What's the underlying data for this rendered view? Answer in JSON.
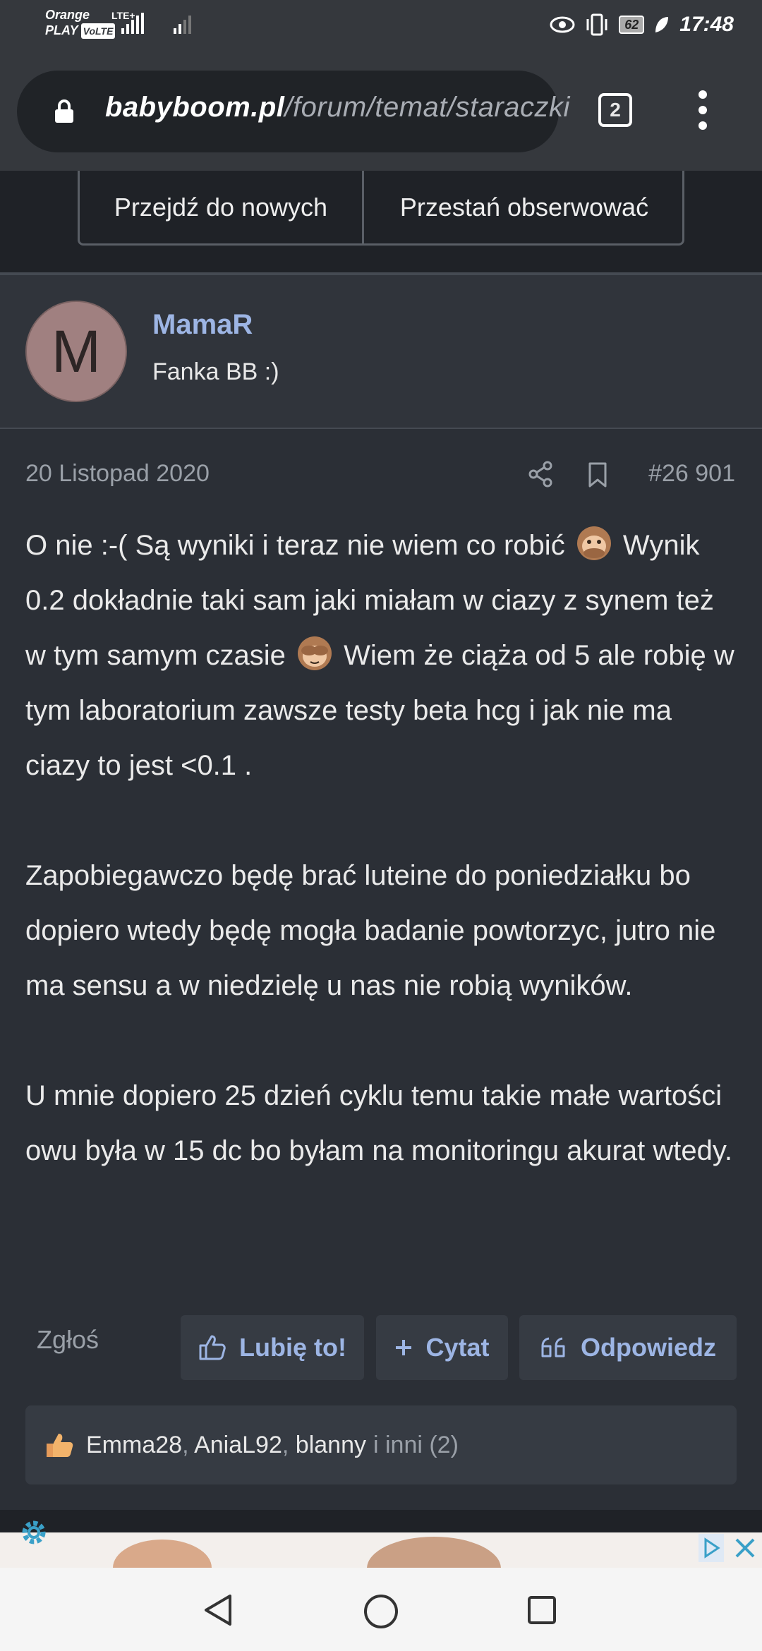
{
  "status_bar": {
    "carrier_1": "Orange",
    "carrier_2": "PLAY",
    "volte": "VoLTE",
    "network": "LTE+",
    "battery": "62",
    "time": "17:48"
  },
  "browser": {
    "url_domain": "babyboom.pl",
    "url_path": "/forum/temat/staraczki",
    "tab_count": "2"
  },
  "thread_actions": {
    "new_posts_label": "Przejdź do nowych",
    "unwatch_label": "Przestań obserwować"
  },
  "post": {
    "author": {
      "avatar_letter": "M",
      "name": "MamaR",
      "title": "Fanka BB :)"
    },
    "date": "20 Listopad 2020",
    "number": "#26 901",
    "paragraphs": {
      "p1_a": "O nie :-( Są wyniki i teraz nie wiem co robić ",
      "p1_b": " Wynik 0.2 dokładnie taki sam jaki miałam w ciazy z synem też w tym samym czasie ",
      "p1_c": " Wiem że ciąża od 5 ale robię w tym laboratorium zawsze testy beta hcg i jak nie ma ciazy to jest <0.1 .",
      "p2": "Zapobiegawczo będę brać luteine do poniedziałku bo dopiero wtedy będę mogła badanie powtorzyc, jutro nie ma sensu a w niedzielę u nas nie robią wyników.",
      "p3": "U mnie dopiero 25 dzień cyklu temu takie małe wartości owu była w 15 dc bo byłam na monitoringu akurat wtedy."
    },
    "actions": {
      "report": "Zgłoś",
      "like": "Lubię to!",
      "quote": "Cytat",
      "reply": "Odpowiedz"
    },
    "reactions": {
      "user_1": "Emma28",
      "user_2": "AniaL92",
      "user_3": "blanny",
      "separator": ",",
      "others": "i inni (2)"
    }
  },
  "icons": {
    "lock": "lock-icon",
    "menu": "more-vert-icon",
    "share": "share-icon",
    "bookmark": "bookmark-icon",
    "like": "thumbs-up-icon",
    "quote": "plus-icon",
    "reply": "quote-icon",
    "reaction": "thumbs-up-emoji-icon",
    "emoji_1": "speak-no-evil-monkey-icon",
    "emoji_2": "see-no-evil-monkey-icon",
    "ad_settings": "gear-icon",
    "ad_choices": "adchoices-icon",
    "ad_close": "close-icon",
    "nav_back": "back-icon",
    "nav_home": "home-icon",
    "nav_recent": "recent-apps-icon"
  },
  "colors": {
    "background": "#2b2f36",
    "accent": "#9db5e4",
    "muted": "#9aa0a8"
  }
}
